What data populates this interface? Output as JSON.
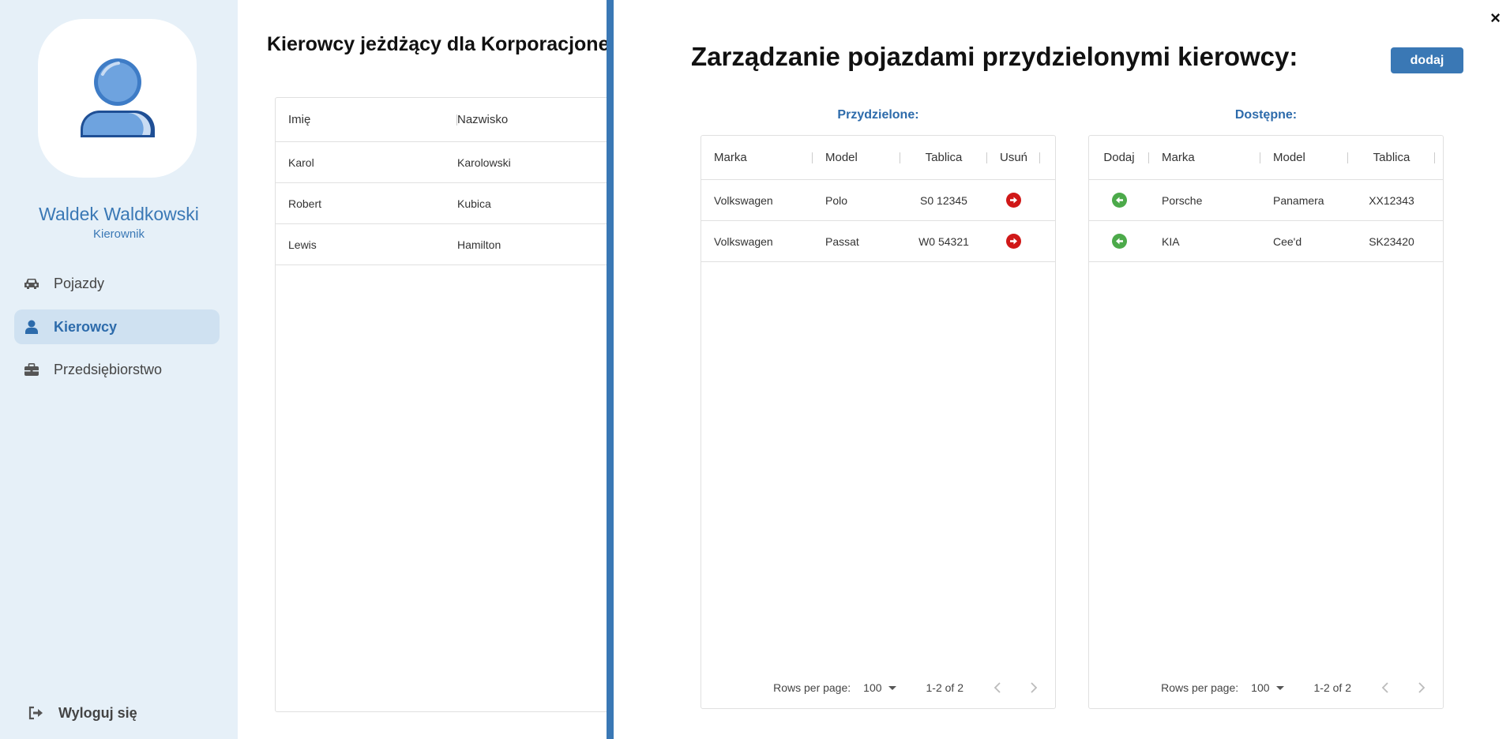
{
  "sidebar": {
    "user_name": "Waldek Waldkowski",
    "user_role": "Kierownik",
    "items": [
      {
        "label": "Pojazdy",
        "icon": "car-icon",
        "active": false
      },
      {
        "label": "Kierowcy",
        "icon": "person-icon",
        "active": true
      },
      {
        "label": "Przedsiębiorstwo",
        "icon": "briefcase-icon",
        "active": false
      }
    ],
    "logout_label": "Wyloguj się",
    "logout_icon": "sign-out-icon"
  },
  "main": {
    "title": "Kierowcy jeżdżący dla Korporacjone",
    "columns": [
      "Imię",
      "Nazwisko"
    ],
    "rows": [
      [
        "Karol",
        "Karolowski"
      ],
      [
        "Robert",
        "Kubica"
      ],
      [
        "Lewis",
        "Hamilton"
      ]
    ]
  },
  "drawer": {
    "close_label": "×",
    "title": "Zarządzanie pojazdami przydzielonymi kierowcy:",
    "add_button_label": "dodaj",
    "assigned": {
      "title": "Przydzielone:",
      "columns": [
        "Marka",
        "Model",
        "Tablica",
        "Usuń"
      ],
      "rows": [
        [
          "Volkswagen",
          "Polo",
          "S0 12345"
        ],
        [
          "Volkswagen",
          "Passat",
          "W0 54321"
        ]
      ],
      "footer": {
        "rows_per_page_label": "Rows per page:",
        "rows_per_page_value": "100",
        "range": "1-2 of 2"
      }
    },
    "available": {
      "title": "Dostępne:",
      "columns": [
        "Dodaj",
        "Marka",
        "Model",
        "Tablica"
      ],
      "rows": [
        [
          "Porsche",
          "Panamera",
          "XX12343"
        ],
        [
          "KIA",
          "Cee'd",
          "SK23420"
        ]
      ],
      "footer": {
        "rows_per_page_label": "Rows per page:",
        "rows_per_page_value": "100",
        "range": "1-2 of 2"
      }
    }
  },
  "colors": {
    "accent": "#3a78b5",
    "sidebar_bg": "#e6f0f8",
    "active_item_bg": "#cfe1f1",
    "remove_red": "#d01818",
    "add_green": "#4caa4a"
  }
}
